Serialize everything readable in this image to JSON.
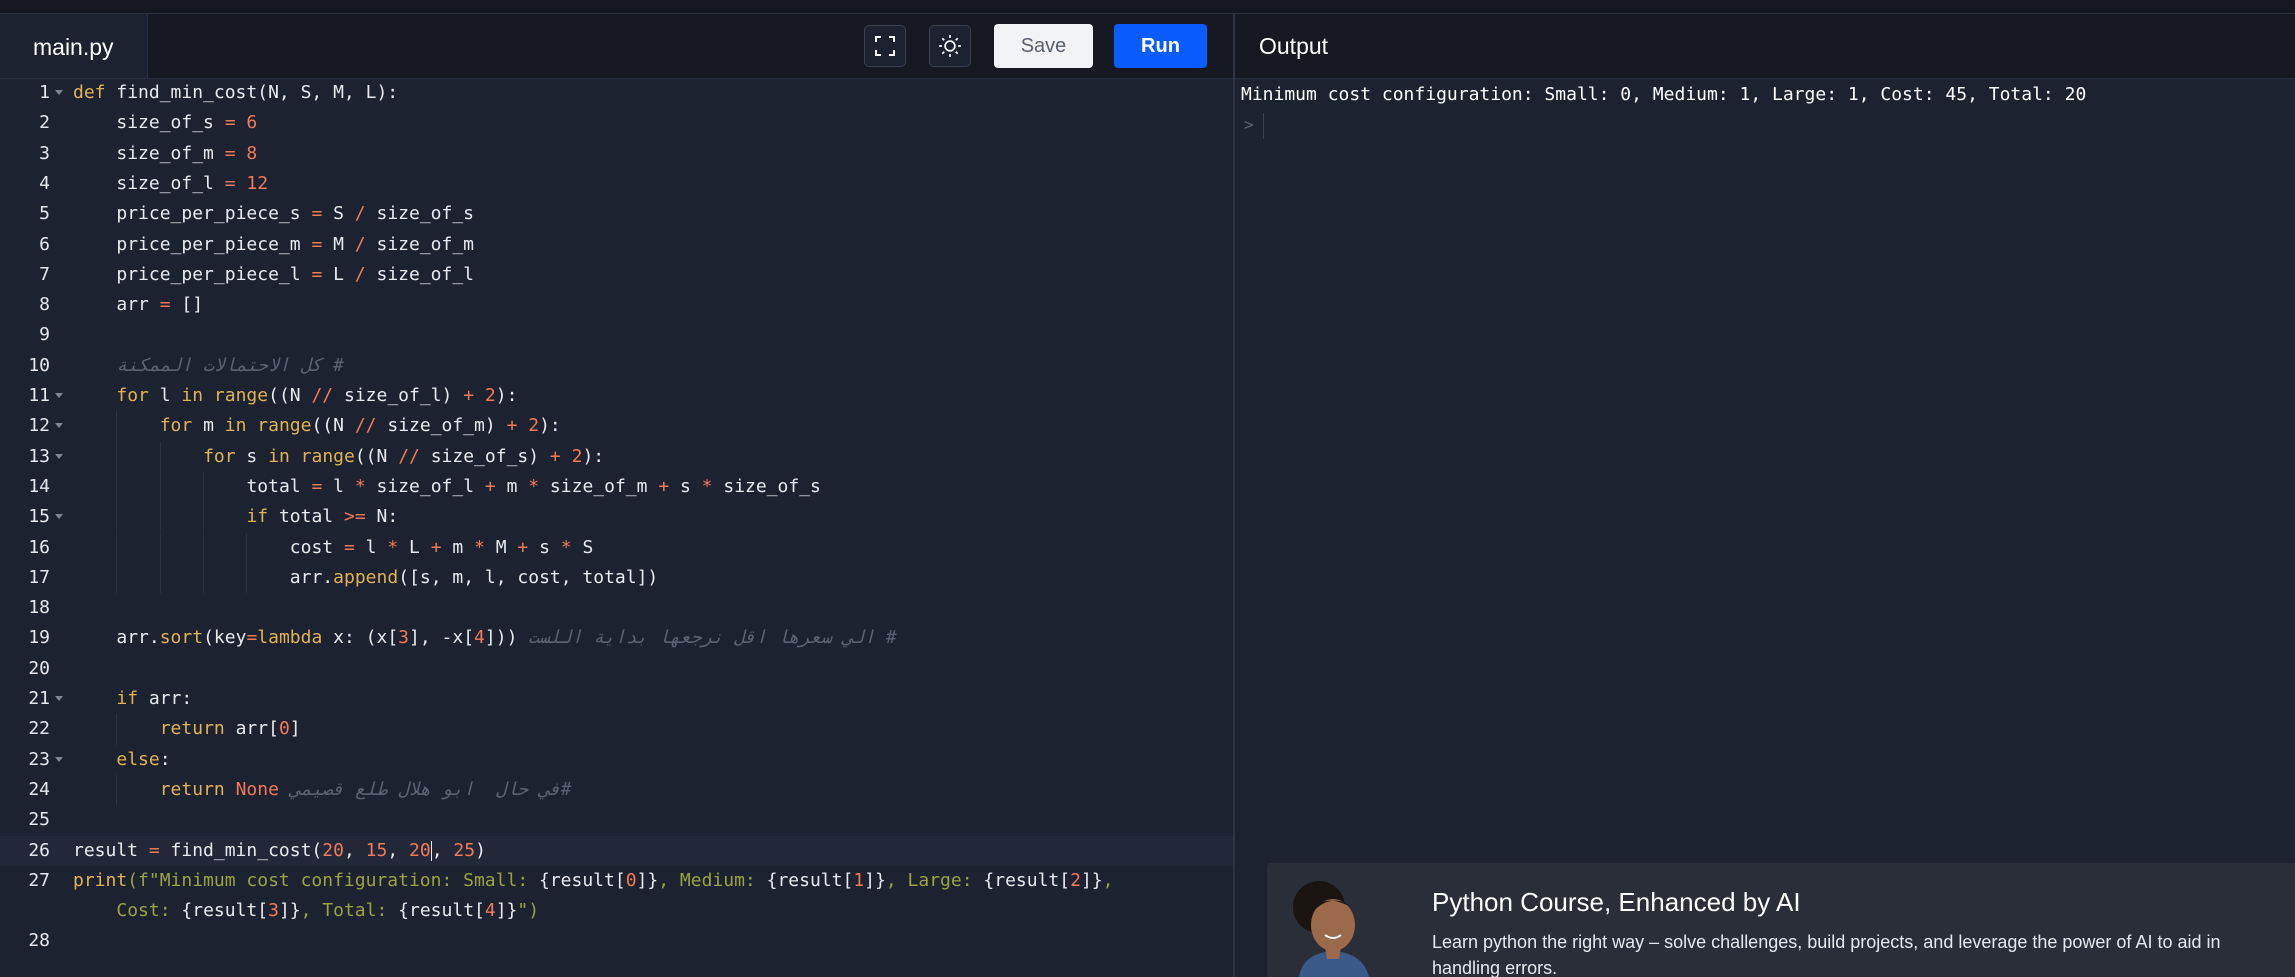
{
  "editor": {
    "tab_label": "main.py",
    "fullscreen_icon": "fullscreen-icon",
    "theme_icon": "sun-icon",
    "save_label": "Save",
    "run_label": "Run",
    "lines": [
      {
        "n": "1",
        "fold": true,
        "indent": 0,
        "tokens": [
          {
            "t": "def",
            "c": "kw"
          },
          {
            "t": " find_min_cost(N, S, M, L):",
            "c": ""
          }
        ]
      },
      {
        "n": "2",
        "fold": false,
        "indent": 1,
        "tokens": [
          {
            "t": "size_of_s ",
            "c": ""
          },
          {
            "t": "=",
            "c": "op"
          },
          {
            "t": " ",
            "c": ""
          },
          {
            "t": "6",
            "c": "num"
          }
        ]
      },
      {
        "n": "3",
        "fold": false,
        "indent": 1,
        "tokens": [
          {
            "t": "size_of_m ",
            "c": ""
          },
          {
            "t": "=",
            "c": "op"
          },
          {
            "t": " ",
            "c": ""
          },
          {
            "t": "8",
            "c": "num"
          }
        ]
      },
      {
        "n": "4",
        "fold": false,
        "indent": 1,
        "tokens": [
          {
            "t": "size_of_l ",
            "c": ""
          },
          {
            "t": "=",
            "c": "op"
          },
          {
            "t": " ",
            "c": ""
          },
          {
            "t": "12",
            "c": "num"
          }
        ]
      },
      {
        "n": "5",
        "fold": false,
        "indent": 1,
        "tokens": [
          {
            "t": "price_per_piece_s ",
            "c": ""
          },
          {
            "t": "=",
            "c": "op"
          },
          {
            "t": " S ",
            "c": ""
          },
          {
            "t": "/",
            "c": "op"
          },
          {
            "t": " size_of_s",
            "c": ""
          }
        ]
      },
      {
        "n": "6",
        "fold": false,
        "indent": 1,
        "tokens": [
          {
            "t": "price_per_piece_m ",
            "c": ""
          },
          {
            "t": "=",
            "c": "op"
          },
          {
            "t": " M ",
            "c": ""
          },
          {
            "t": "/",
            "c": "op"
          },
          {
            "t": " size_of_m",
            "c": ""
          }
        ]
      },
      {
        "n": "7",
        "fold": false,
        "indent": 1,
        "tokens": [
          {
            "t": "price_per_piece_l ",
            "c": ""
          },
          {
            "t": "=",
            "c": "op"
          },
          {
            "t": " L ",
            "c": ""
          },
          {
            "t": "/",
            "c": "op"
          },
          {
            "t": " size_of_l",
            "c": ""
          }
        ]
      },
      {
        "n": "8",
        "fold": false,
        "indent": 1,
        "tokens": [
          {
            "t": "arr ",
            "c": ""
          },
          {
            "t": "=",
            "c": "op"
          },
          {
            "t": " []",
            "c": ""
          }
        ]
      },
      {
        "n": "9",
        "fold": false,
        "indent": 0,
        "tokens": []
      },
      {
        "n": "10",
        "fold": false,
        "indent": 1,
        "tokens": [
          {
            "t": "# كل الاحتمالات الممكنة",
            "c": "cm"
          }
        ]
      },
      {
        "n": "11",
        "fold": true,
        "indent": 1,
        "tokens": [
          {
            "t": "for",
            "c": "kw"
          },
          {
            "t": " l ",
            "c": ""
          },
          {
            "t": "in",
            "c": "kw"
          },
          {
            "t": " ",
            "c": ""
          },
          {
            "t": "range",
            "c": "fn"
          },
          {
            "t": "((N ",
            "c": ""
          },
          {
            "t": "//",
            "c": "op"
          },
          {
            "t": " size_of_l) ",
            "c": ""
          },
          {
            "t": "+",
            "c": "op"
          },
          {
            "t": " ",
            "c": ""
          },
          {
            "t": "2",
            "c": "num"
          },
          {
            "t": "):",
            "c": ""
          }
        ]
      },
      {
        "n": "12",
        "fold": true,
        "indent": 2,
        "tokens": [
          {
            "t": "for",
            "c": "kw"
          },
          {
            "t": " m ",
            "c": ""
          },
          {
            "t": "in",
            "c": "kw"
          },
          {
            "t": " ",
            "c": ""
          },
          {
            "t": "range",
            "c": "fn"
          },
          {
            "t": "((N ",
            "c": ""
          },
          {
            "t": "//",
            "c": "op"
          },
          {
            "t": " size_of_m) ",
            "c": ""
          },
          {
            "t": "+",
            "c": "op"
          },
          {
            "t": " ",
            "c": ""
          },
          {
            "t": "2",
            "c": "num"
          },
          {
            "t": "):",
            "c": ""
          }
        ]
      },
      {
        "n": "13",
        "fold": true,
        "indent": 3,
        "tokens": [
          {
            "t": "for",
            "c": "kw"
          },
          {
            "t": " s ",
            "c": ""
          },
          {
            "t": "in",
            "c": "kw"
          },
          {
            "t": " ",
            "c": ""
          },
          {
            "t": "range",
            "c": "fn"
          },
          {
            "t": "((N ",
            "c": ""
          },
          {
            "t": "//",
            "c": "op"
          },
          {
            "t": " size_of_s) ",
            "c": ""
          },
          {
            "t": "+",
            "c": "op"
          },
          {
            "t": " ",
            "c": ""
          },
          {
            "t": "2",
            "c": "num"
          },
          {
            "t": "):",
            "c": ""
          }
        ]
      },
      {
        "n": "14",
        "fold": false,
        "indent": 4,
        "tokens": [
          {
            "t": "total ",
            "c": ""
          },
          {
            "t": "=",
            "c": "op"
          },
          {
            "t": " l ",
            "c": ""
          },
          {
            "t": "*",
            "c": "op"
          },
          {
            "t": " size_of_l ",
            "c": ""
          },
          {
            "t": "+",
            "c": "op"
          },
          {
            "t": " m ",
            "c": ""
          },
          {
            "t": "*",
            "c": "op"
          },
          {
            "t": " size_of_m ",
            "c": ""
          },
          {
            "t": "+",
            "c": "op"
          },
          {
            "t": " s ",
            "c": ""
          },
          {
            "t": "*",
            "c": "op"
          },
          {
            "t": " size_of_s",
            "c": ""
          }
        ]
      },
      {
        "n": "15",
        "fold": true,
        "indent": 4,
        "tokens": [
          {
            "t": "if",
            "c": "kw"
          },
          {
            "t": " total ",
            "c": ""
          },
          {
            "t": ">=",
            "c": "op"
          },
          {
            "t": " N:",
            "c": ""
          }
        ]
      },
      {
        "n": "16",
        "fold": false,
        "indent": 5,
        "tokens": [
          {
            "t": "cost ",
            "c": ""
          },
          {
            "t": "=",
            "c": "op"
          },
          {
            "t": " l ",
            "c": ""
          },
          {
            "t": "*",
            "c": "op"
          },
          {
            "t": " L ",
            "c": ""
          },
          {
            "t": "+",
            "c": "op"
          },
          {
            "t": " m ",
            "c": ""
          },
          {
            "t": "*",
            "c": "op"
          },
          {
            "t": " M ",
            "c": ""
          },
          {
            "t": "+",
            "c": "op"
          },
          {
            "t": " s ",
            "c": ""
          },
          {
            "t": "*",
            "c": "op"
          },
          {
            "t": " S",
            "c": ""
          }
        ]
      },
      {
        "n": "17",
        "fold": false,
        "indent": 5,
        "tokens": [
          {
            "t": "arr.",
            "c": ""
          },
          {
            "t": "append",
            "c": "fn"
          },
          {
            "t": "([s, m, l, cost, total])",
            "c": ""
          }
        ]
      },
      {
        "n": "18",
        "fold": false,
        "indent": 0,
        "tokens": []
      },
      {
        "n": "19",
        "fold": false,
        "indent": 1,
        "tokens": [
          {
            "t": "arr.",
            "c": ""
          },
          {
            "t": "sort",
            "c": "fn"
          },
          {
            "t": "(key",
            "c": ""
          },
          {
            "t": "=",
            "c": "op"
          },
          {
            "t": "lambda",
            "c": "kw"
          },
          {
            "t": " x: (x[",
            "c": ""
          },
          {
            "t": "3",
            "c": "num"
          },
          {
            "t": "], -x[",
            "c": ""
          },
          {
            "t": "4",
            "c": "num"
          },
          {
            "t": "])) ",
            "c": ""
          },
          {
            "t": "# الي سعرها اقل نرجعها بداية اللست",
            "c": "cm"
          }
        ]
      },
      {
        "n": "20",
        "fold": false,
        "indent": 0,
        "tokens": []
      },
      {
        "n": "21",
        "fold": true,
        "indent": 1,
        "tokens": [
          {
            "t": "if",
            "c": "kw"
          },
          {
            "t": " arr:",
            "c": ""
          }
        ]
      },
      {
        "n": "22",
        "fold": false,
        "indent": 2,
        "tokens": [
          {
            "t": "return",
            "c": "kw"
          },
          {
            "t": " arr[",
            "c": ""
          },
          {
            "t": "0",
            "c": "num"
          },
          {
            "t": "]",
            "c": ""
          }
        ]
      },
      {
        "n": "23",
        "fold": true,
        "indent": 1,
        "tokens": [
          {
            "t": "else",
            "c": "kw"
          },
          {
            "t": ":",
            "c": ""
          }
        ]
      },
      {
        "n": "24",
        "fold": false,
        "indent": 2,
        "tokens": [
          {
            "t": "return",
            "c": "kw"
          },
          {
            "t": " ",
            "c": ""
          },
          {
            "t": "None",
            "c": "nonec"
          },
          {
            "t": " ",
            "c": ""
          },
          {
            "t": "#في حال  ابو هلال طلع قصيمي",
            "c": "cm"
          }
        ]
      },
      {
        "n": "25",
        "fold": false,
        "indent": 0,
        "tokens": []
      },
      {
        "n": "26",
        "fold": false,
        "indent": 0,
        "active": true,
        "tokens": [
          {
            "t": "result ",
            "c": ""
          },
          {
            "t": "=",
            "c": "op"
          },
          {
            "t": " find_min_cost(",
            "c": ""
          },
          {
            "t": "20",
            "c": "num"
          },
          {
            "t": ", ",
            "c": ""
          },
          {
            "t": "15",
            "c": "num"
          },
          {
            "t": ", ",
            "c": ""
          },
          {
            "t": "20",
            "c": "num"
          },
          {
            "t": "|",
            "c": "cursor"
          },
          {
            "t": ", ",
            "c": ""
          },
          {
            "t": "25",
            "c": "num"
          },
          {
            "t": ")",
            "c": ""
          }
        ]
      },
      {
        "n": "27",
        "fold": false,
        "indent": 0,
        "tokens": [
          {
            "t": "print",
            "c": "kw"
          },
          {
            "t": "(f\"Minimum cost configuration: Small: ",
            "c": "str"
          },
          {
            "t": "{result[",
            "c": ""
          },
          {
            "t": "0",
            "c": "num"
          },
          {
            "t": "]}",
            "c": ""
          },
          {
            "t": ", Medium: ",
            "c": "str"
          },
          {
            "t": "{result[",
            "c": ""
          },
          {
            "t": "1",
            "c": "num"
          },
          {
            "t": "]}",
            "c": ""
          },
          {
            "t": ", Large: ",
            "c": "str"
          },
          {
            "t": "{result[",
            "c": ""
          },
          {
            "t": "2",
            "c": "num"
          },
          {
            "t": "]}",
            "c": ""
          },
          {
            "t": ",",
            "c": "str"
          }
        ]
      },
      {
        "n": "",
        "fold": false,
        "indent": 1,
        "tokens": [
          {
            "t": "Cost: ",
            "c": "str"
          },
          {
            "t": "{result[",
            "c": ""
          },
          {
            "t": "3",
            "c": "num"
          },
          {
            "t": "]}",
            "c": ""
          },
          {
            "t": ", Total: ",
            "c": "str"
          },
          {
            "t": "{result[",
            "c": ""
          },
          {
            "t": "4",
            "c": "num"
          },
          {
            "t": "]}",
            "c": ""
          },
          {
            "t": "\")",
            "c": "str"
          }
        ]
      },
      {
        "n": "28",
        "fold": false,
        "indent": 0,
        "tokens": []
      }
    ]
  },
  "output": {
    "title": "Output",
    "text": "Minimum cost configuration: Small: 0, Medium: 1, Large: 1, Cost: 45, Total: 20",
    "prompt": ">"
  },
  "promo": {
    "title": "Python Course, Enhanced by AI",
    "description": "Learn python the right way – solve challenges, build projects, and leverage the power of AI to aid in handling errors.",
    "avatar": "instructor-photo"
  },
  "colors": {
    "background": "#1d2230",
    "header": "#161922",
    "run_button": "#0b5cff",
    "keyword": "#e0b355",
    "number": "#f07a5a",
    "comment": "#5c6272",
    "string": "#9aa33f"
  }
}
